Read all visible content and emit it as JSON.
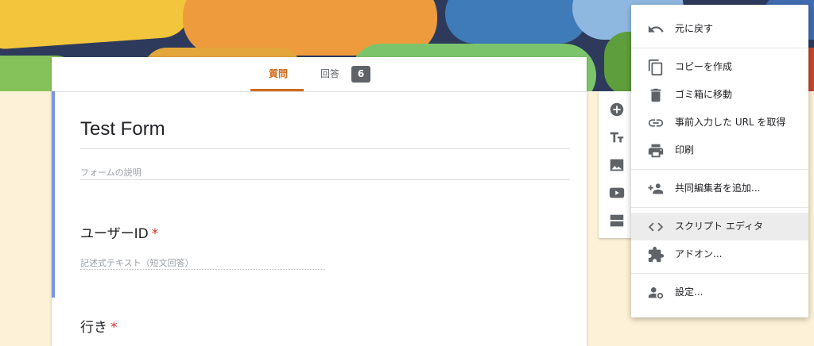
{
  "form": {
    "tabs": [
      {
        "label": "質問",
        "active": true
      },
      {
        "label": "回答",
        "active": false
      }
    ],
    "responses_count": "6",
    "title": "Test Form",
    "description_placeholder": "フォームの説明",
    "questions": [
      {
        "label": "ユーザーID",
        "required_mark": "*",
        "hint": "記述式テキスト（短文回答）"
      },
      {
        "label": "行き",
        "required_mark": "*"
      }
    ]
  },
  "toolbar": {
    "icons": [
      "add-question-icon",
      "add-title-icon",
      "add-image-icon",
      "add-video-icon",
      "add-section-icon"
    ]
  },
  "menu": {
    "items": [
      {
        "label": "元に戻す",
        "icon": "undo-icon"
      },
      {
        "label": "コピーを作成",
        "icon": "copy-icon"
      },
      {
        "label": "ゴミ箱に移動",
        "icon": "trash-icon"
      },
      {
        "label": "事前入力した URL を取得",
        "icon": "link-icon"
      },
      {
        "label": "印刷",
        "icon": "print-icon"
      },
      {
        "label": "共同編集者を追加...",
        "icon": "add-people-icon"
      },
      {
        "label": "スクリプト エディタ",
        "icon": "code-icon",
        "highlighted": true
      },
      {
        "label": "アドオン...",
        "icon": "puzzle-icon"
      },
      {
        "label": "設定...",
        "icon": "settings-person-icon"
      }
    ]
  },
  "colors": {
    "accent": "#d46a1b",
    "page_background": "#fdf2d7",
    "section_bar": "#7b93e8",
    "required": "#d93025"
  }
}
